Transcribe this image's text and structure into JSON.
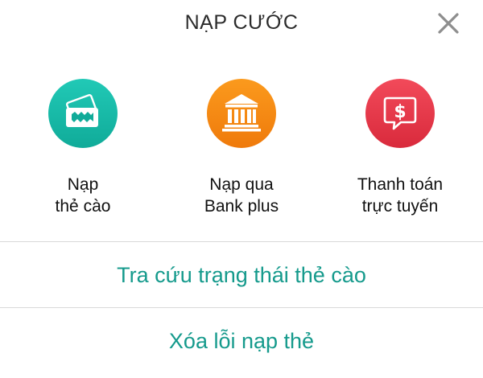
{
  "header": {
    "title": "NẠP CƯỚC",
    "close_icon": "close-icon"
  },
  "options": [
    {
      "icon": "scratch-card-icon",
      "color": "#14b8a6",
      "label_lines": [
        "Nạp",
        "thẻ cào"
      ]
    },
    {
      "icon": "bank-icon",
      "color": "#f5890f",
      "label_lines": [
        "Nạp qua",
        "Bank plus"
      ]
    },
    {
      "icon": "dollar-chat-icon",
      "color": "#e33547",
      "label_lines": [
        "Thanh toán",
        "trực tuyến"
      ]
    }
  ],
  "actions": {
    "check_card_status": "Tra cứu trạng thái thẻ cào",
    "clear_topup_error": "Xóa lỗi nạp thẻ",
    "color": "#159a8c"
  },
  "colors": {
    "divider": "#d9d9d9",
    "close_icon": "#8e8e8e"
  }
}
